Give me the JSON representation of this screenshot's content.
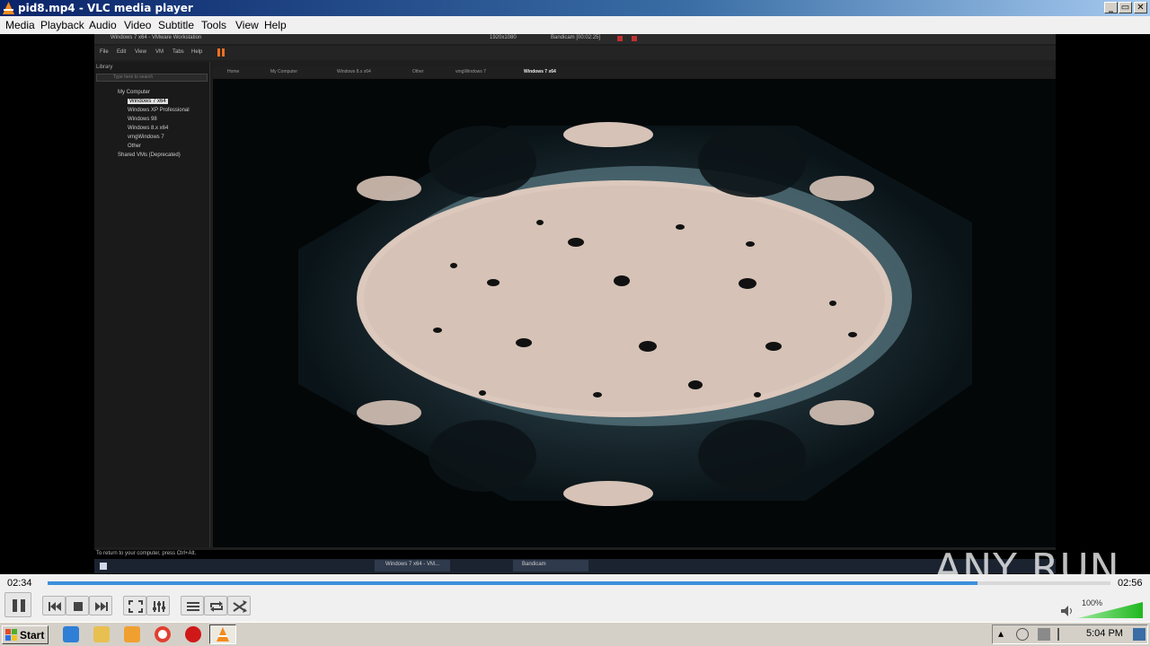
{
  "window": {
    "title": "pid8.mp4 - VLC media player"
  },
  "menu": [
    "Media",
    "Playback",
    "Audio",
    "Video",
    "Subtitle",
    "Tools",
    "View",
    "Help"
  ],
  "video_frame": {
    "vm_title": "Windows 7 x64 - VMware Workstation",
    "recorder_resolution": "1920x1080",
    "recorder_camera": "Bandicam [00:02:25]",
    "vm_menu": [
      "File",
      "Edit",
      "View",
      "VM",
      "Tabs",
      "Help"
    ],
    "library_title": "Library",
    "library_search": "Type here to search",
    "library_root": "My Computer",
    "library_items": [
      "Windows 7 x64",
      "Windows XP Professional",
      "Windows 98",
      "Windows 8.x x64",
      "vmgWindows 7",
      "Other"
    ],
    "library_shared": "Shared VMs (Deprecated)",
    "tabs": [
      "Home",
      "My Computer",
      "Windows 8.x x64",
      "Other",
      "vmgWindows 7",
      "Windows 7 x64"
    ],
    "status_text": "To return to your computer, press Ctrl+Alt.",
    "taskbar_items": [
      "Windows 7 x64 - VM...",
      "Bandicam"
    ]
  },
  "player": {
    "elapsed": "02:34",
    "total": "02:56",
    "progress_fraction": 0.875,
    "volume_label": "100%",
    "volume_fraction": 1.0
  },
  "taskbar": {
    "start_label": "Start",
    "quicklaunch": [
      "ie-icon",
      "folder-icon",
      "media-player-icon",
      "chrome-icon",
      "opera-icon",
      "vlc-icon"
    ],
    "clock": "5:04 PM"
  },
  "watermark": "ANY RUN",
  "colors": {
    "seek_fill": "#3c8fdc",
    "title_start": "#0a246a",
    "vlc_orange": "#f28c1c",
    "volume_green": "#2ec82e"
  }
}
